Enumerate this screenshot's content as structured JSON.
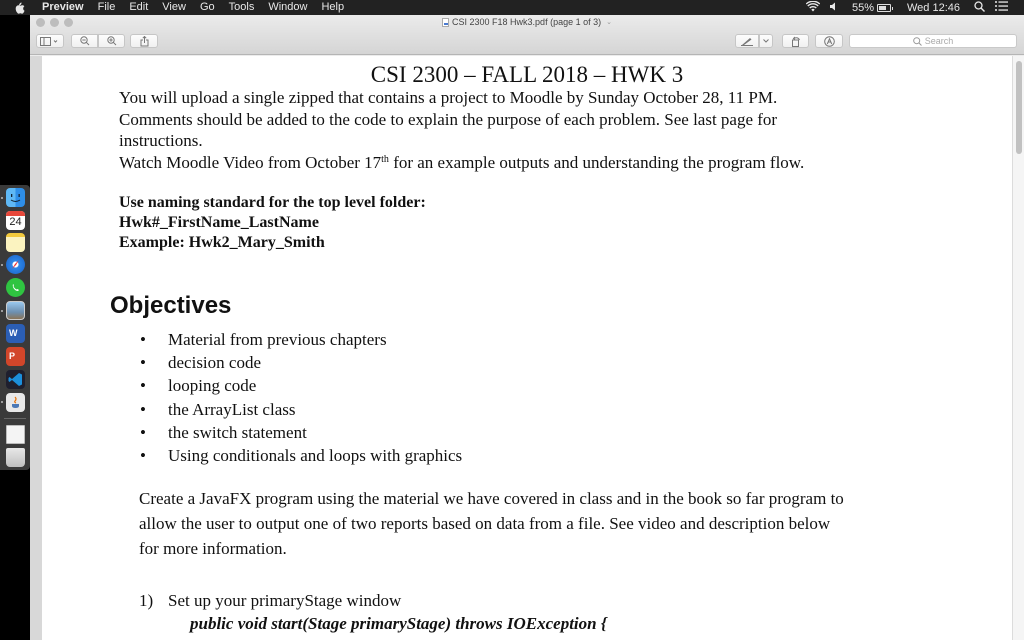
{
  "menubar": {
    "app_name": "Preview",
    "menus": [
      "File",
      "Edit",
      "View",
      "Go",
      "Tools",
      "Window",
      "Help"
    ],
    "battery_percent": "55%",
    "battery_level": 0.55,
    "clock": "Wed 12:46"
  },
  "dock": {
    "items": [
      {
        "name": "Finder",
        "running": true
      },
      {
        "name": "Calendar",
        "running": false,
        "date": "24"
      },
      {
        "name": "Notes",
        "running": false
      },
      {
        "name": "Safari",
        "running": true
      },
      {
        "name": "WhatsApp",
        "running": false
      },
      {
        "name": "Preview",
        "running": true
      },
      {
        "name": "Microsoft Word",
        "running": false
      },
      {
        "name": "Microsoft PowerPoint",
        "running": false
      },
      {
        "name": "Visual Studio Code",
        "running": false
      },
      {
        "name": "Java",
        "running": true
      },
      {
        "name": "Document",
        "running": false
      },
      {
        "name": "Trash",
        "running": false
      }
    ]
  },
  "window": {
    "title": "CSI 2300 F18 Hwk3.pdf (page 1 of 3)",
    "search_placeholder": "Search"
  },
  "document": {
    "title": "CSI 2300 – FALL 2018 – HWK 3",
    "intro_line1": "You will upload a single zipped that contains a project to Moodle by Sunday October 28, 11 PM.",
    "intro_line2": "Comments should be added to the code to explain the purpose of each problem. See last page for",
    "intro_line3": "instructions.",
    "video_pre": "Watch Moodle Video from October 17",
    "video_sup": "th",
    "video_post": " for an example outputs and understanding the program flow.",
    "naming_line1": "Use naming standard for the top level folder:",
    "naming_line2": "Hwk#_FirstName_LastName",
    "naming_line3": "Example: Hwk2_Mary_Smith",
    "objectives_heading": "Objectives",
    "objectives": [
      "Material from previous chapters",
      "decision code",
      "looping code",
      "the ArrayList class",
      "the switch statement",
      "Using conditionals and loops with graphics"
    ],
    "desc_line1": "Create a JavaFX program using the material we have covered in class and in the book so far program to",
    "desc_line2": "allow the user to output one of two reports based on data from a file.  See video and description below",
    "desc_line3": "for more information.",
    "step1_num": "1)",
    "step1_text": "Set up your primaryStage window",
    "code_line": "public void start(Stage primaryStage) throws IOException {"
  }
}
